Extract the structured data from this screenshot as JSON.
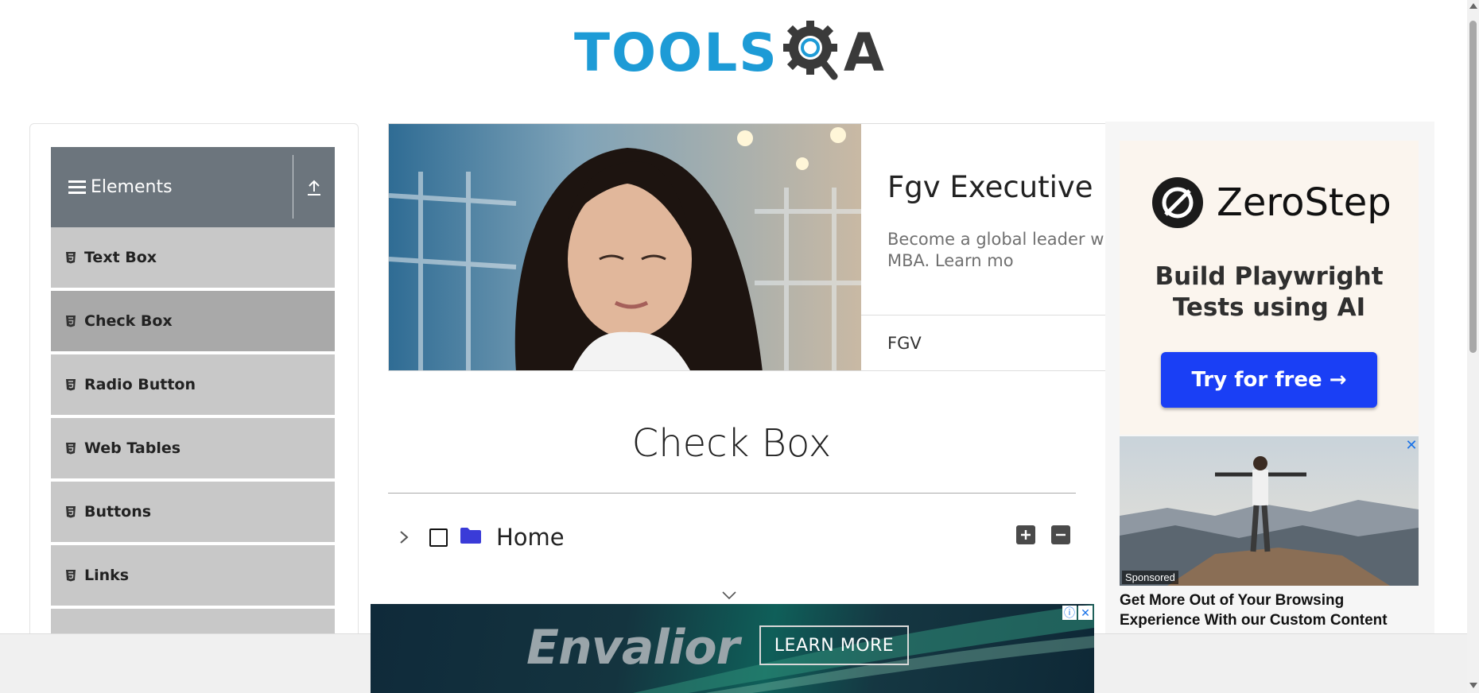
{
  "header": {
    "logo_text": "TOOLS",
    "logo_suffix": "A"
  },
  "sidebar": {
    "group_title": "Elements",
    "items": [
      {
        "label": "Text Box"
      },
      {
        "label": "Check Box"
      },
      {
        "label": "Radio Button"
      },
      {
        "label": "Web Tables"
      },
      {
        "label": "Buttons"
      },
      {
        "label": "Links"
      }
    ],
    "active_index": 1
  },
  "ad_top": {
    "title": "Fgv Executive M",
    "description": "Become a global leader wit recognized MBA. Learn mo",
    "brand": "FGV"
  },
  "ad_right": {
    "brand": "ZeroStep",
    "tagline": "Build Playwright Tests using AI",
    "cta": "Try for free →",
    "sponsored_badge": "Sponsored",
    "sponsored_headline": "Get More Out of Your Browsing Experience With our Custom Content",
    "close_glyph": "✕"
  },
  "main": {
    "title": "Check Box",
    "tree_root_label": "Home"
  },
  "ad_bottom": {
    "brand": "Envalior",
    "cta": "LEARN MORE",
    "info_glyph": "ⓘ",
    "close_glyph": "✕"
  },
  "colors": {
    "logo_blue": "#1d9bd6",
    "sidebar_header": "#6c757d",
    "menu_item": "#c8c8c8",
    "menu_item_active": "#a9a9a9",
    "folder_icon": "#3a3bd8",
    "cta_blue": "#1a3ff5"
  }
}
